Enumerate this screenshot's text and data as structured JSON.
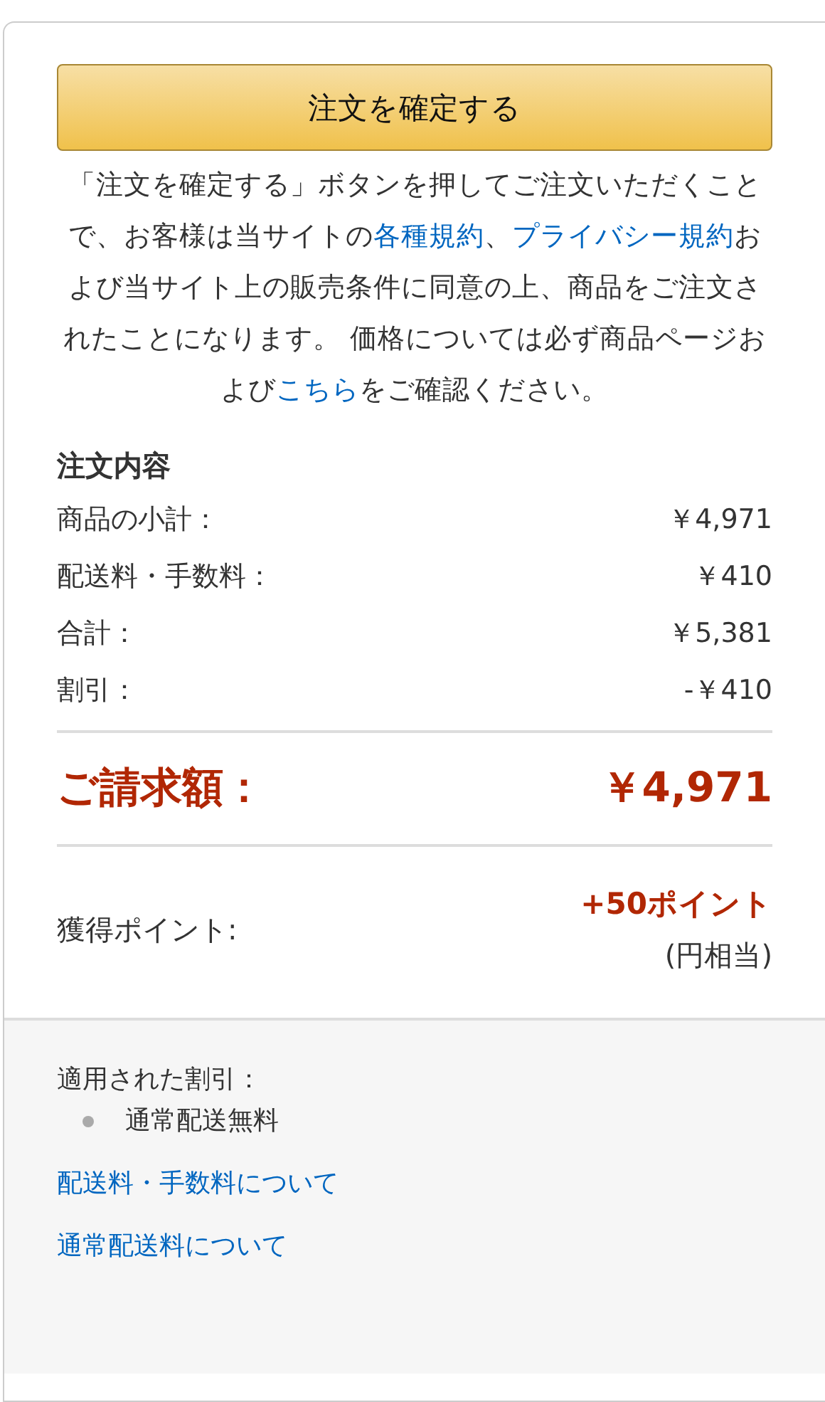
{
  "place_order_button": {
    "label": "注文を確定する"
  },
  "notice": [
    {
      "kind": "text",
      "text": "「注文を確定する」ボタンを押してご注文いただくことで、お客様は当サイトの"
    },
    {
      "kind": "link",
      "text": "各種規約"
    },
    {
      "kind": "text",
      "text": "、"
    },
    {
      "kind": "link",
      "text": "プライバシー規約"
    },
    {
      "kind": "text",
      "text": "および当サイト上の販売条件に同意の上、商品をご注文されたことになります。 価格については必ず商品ページおよび"
    },
    {
      "kind": "link",
      "text": "こちら"
    },
    {
      "kind": "text",
      "text": "をご確認ください。"
    }
  ],
  "order_summary": {
    "title": "注文内容",
    "rows": [
      {
        "label": "商品の小計：",
        "value": "￥4,971"
      },
      {
        "label": "配送料・手数料：",
        "value": "￥410"
      },
      {
        "label": "合計：",
        "value": "￥5,381"
      },
      {
        "label": "割引：",
        "value": "-￥410"
      }
    ],
    "total": {
      "label": "ご請求額：",
      "value": "￥4,971"
    },
    "points": {
      "label": "獲得ポイント:",
      "value": "+50ポイント",
      "note": "(円相当)"
    }
  },
  "discounts": {
    "title": "適用された割引：",
    "items": [
      "通常配送無料"
    ],
    "links": [
      "配送料・手数料について",
      "通常配送料について"
    ]
  }
}
